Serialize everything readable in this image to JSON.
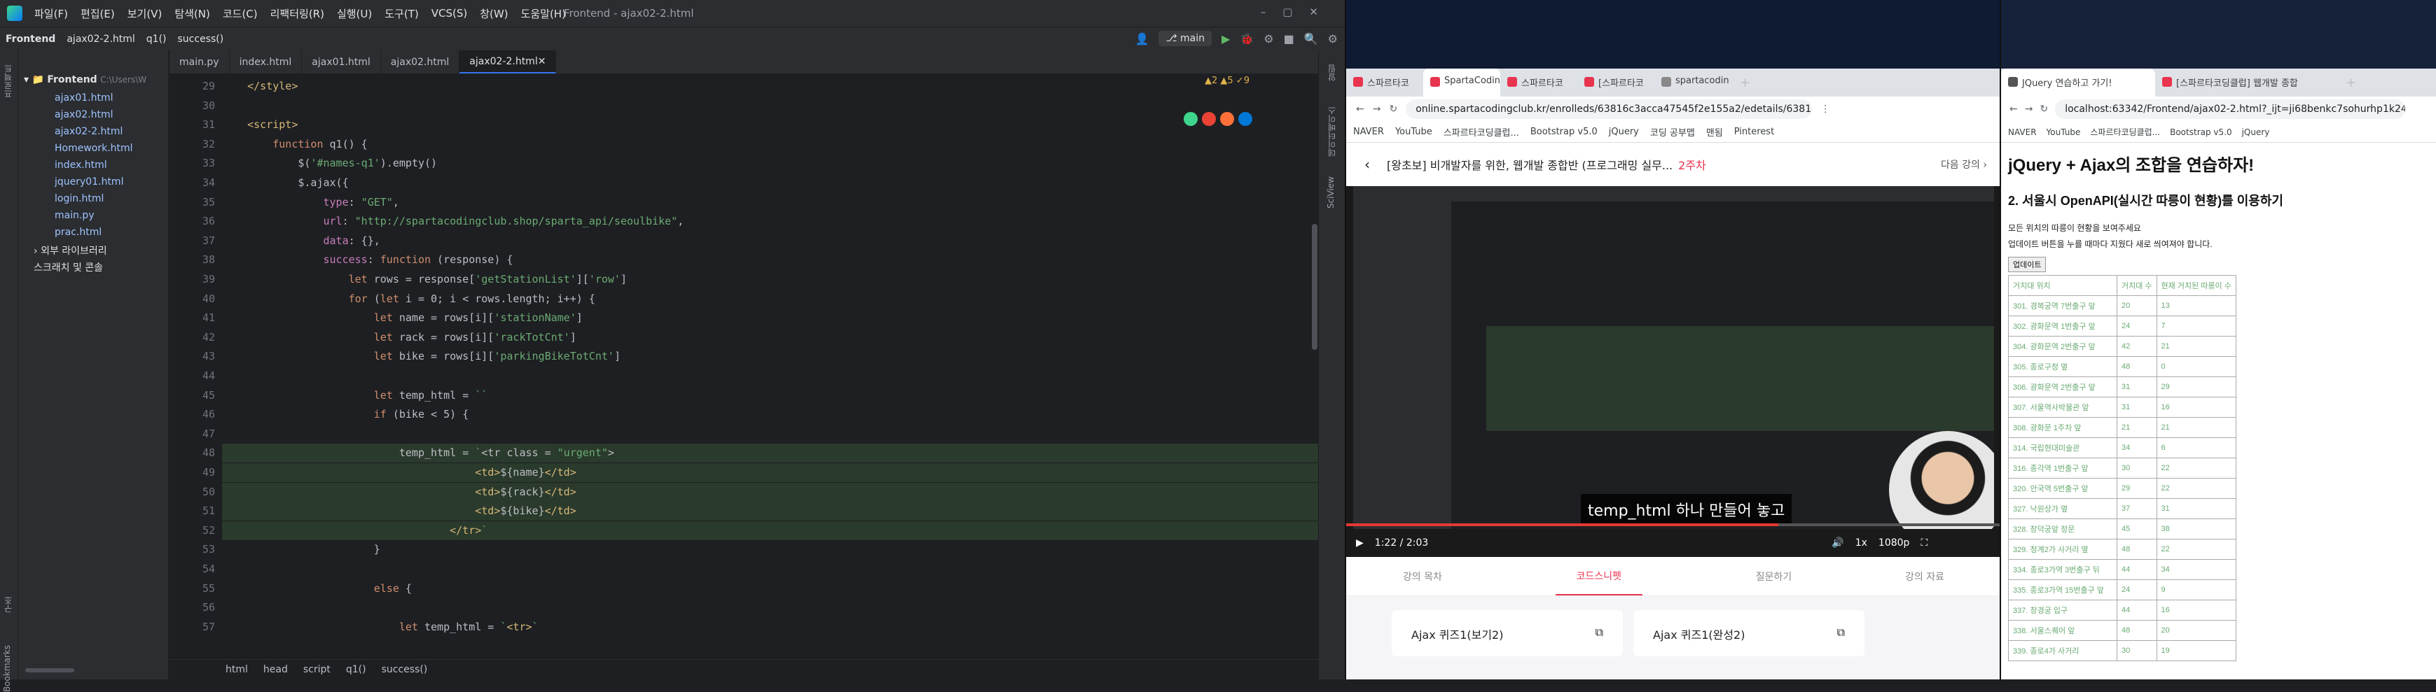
{
  "ide": {
    "menu": [
      "파일(F)",
      "편집(E)",
      "보기(V)",
      "탐색(N)",
      "코드(C)",
      "리팩터링(R)",
      "실행(U)",
      "도구(T)",
      "VCS(S)",
      "창(W)",
      "도움말(H)"
    ],
    "window_title": "Frontend - ajax02-2.html",
    "nav": [
      "Frontend",
      "ajax02-2.html",
      "q1()",
      "success()"
    ],
    "branch": "main",
    "project": {
      "root": "Frontend",
      "root_path": "C:\\Users\\W",
      "files": [
        "ajax01.html",
        "ajax02.html",
        "ajax02-2.html",
        "Homework.html",
        "index.html",
        "jquery01.html",
        "login.html",
        "main.py",
        "prac.html"
      ],
      "ext_lib": "외부 라이브러리",
      "scratch": "스크래치 및 콘솔"
    },
    "tabs": [
      "main.py",
      "index.html",
      "ajax01.html",
      "ajax02.html",
      "ajax02-2.html"
    ],
    "active_tab": "ajax02-2.html",
    "inspections": "▲2 ▲5 ✓9",
    "lines": [
      {
        "n": "29",
        "t": "    </style>"
      },
      {
        "n": "30",
        "t": ""
      },
      {
        "n": "31",
        "t": "    <script>"
      },
      {
        "n": "32",
        "t": "        function q1() {"
      },
      {
        "n": "33",
        "t": "            $('#names-q1').empty()"
      },
      {
        "n": "34",
        "t": "            $.ajax({"
      },
      {
        "n": "35",
        "t": "                type: \"GET\","
      },
      {
        "n": "36",
        "t": "                url: \"http://spartacodingclub.shop/sparta_api/seoulbike\","
      },
      {
        "n": "37",
        "t": "                data: {},"
      },
      {
        "n": "38",
        "t": "                success: function (response) {"
      },
      {
        "n": "39",
        "t": "                    let rows = response['getStationList']['row']"
      },
      {
        "n": "40",
        "t": "                    for (let i = 0; i < rows.length; i++) {"
      },
      {
        "n": "41",
        "t": "                        let name = rows[i]['stationName']"
      },
      {
        "n": "42",
        "t": "                        let rack = rows[i]['rackTotCnt']"
      },
      {
        "n": "43",
        "t": "                        let bike = rows[i]['parkingBikeTotCnt']"
      },
      {
        "n": "44",
        "t": ""
      },
      {
        "n": "45",
        "t": "                        let temp_html = ``"
      },
      {
        "n": "46",
        "t": "                        if (bike < 5) {"
      },
      {
        "n": "47",
        "t": ""
      },
      {
        "n": "48",
        "t": "                            temp_html = `<tr class = \"urgent\">"
      },
      {
        "n": "49",
        "t": "                                        <td>${name}</td>"
      },
      {
        "n": "50",
        "t": "                                        <td>${rack}</td>"
      },
      {
        "n": "51",
        "t": "                                        <td>${bike}</td>"
      },
      {
        "n": "52",
        "t": "                                    </tr>`"
      },
      {
        "n": "53",
        "t": "                        }"
      },
      {
        "n": "54",
        "t": ""
      },
      {
        "n": "55",
        "t": "                        else {"
      },
      {
        "n": "56",
        "t": ""
      },
      {
        "n": "57",
        "t": "                            let temp_html = `<tr>`"
      }
    ],
    "breadcrumb": [
      "html",
      "head",
      "script",
      "q1()",
      "success()"
    ],
    "left_tabs": [
      "프로젝트",
      "구조",
      "Bookmarks"
    ],
    "right_tabs": [
      "알림",
      "데이터베이스",
      "SciView"
    ]
  },
  "browser1": {
    "tabs": [
      "스파르타코",
      "SpartaCodin",
      "스파르타코",
      "[스파르타코",
      "spartacodin"
    ],
    "url": "online.spartacodingclub.kr/enrolleds/63816c3acca47545f2e155a2/edetails/63816c3acca...",
    "bookmarks": [
      "NAVER",
      "YouTube",
      "스파르타코딩클럽...",
      "Bootstrap v5.0",
      "jQuery",
      "코딩 공부맵",
      "맨됨",
      "Pinterest"
    ],
    "lecture_title": "[왕초보] 비개발자를 위한, 웹개발 종합반 (프로그래밍 실무...",
    "week": "2주차",
    "next": "다음 강의",
    "caption": "temp_html 하나 만들어 놓고",
    "time": "1:22 / 2:03",
    "quality": "1080p",
    "speed": "1x",
    "progress": 0.66,
    "nav": [
      "강의 목차",
      "코드스니펫",
      "질문하기",
      "강의 자료"
    ],
    "active_nav": "코드스니펫",
    "quiz": [
      "Ajax 퀴즈1(보기2)",
      "Ajax 퀴즈1(완성2)"
    ]
  },
  "browser2": {
    "tabs": [
      "JQuery 연습하고 가기!",
      "[스파르타코딩클럽] 웹개발 종합"
    ],
    "url": "localhost:63342/Frontend/ajax02-2.html?_ijt=ji68benkc7sohurhp1k24np1q",
    "bookmarks": [
      "NAVER",
      "YouTube",
      "스파르타코딩클럽...",
      "Bootstrap v5.0",
      "jQuery"
    ],
    "h1": "jQuery + Ajax의 조합을 연습하자!",
    "h2": "2. 서울시 OpenAPI(실시간 따릉이 현황)를 이용하기",
    "p1": "모든 위치의 따릉이 현황을 보여주세요",
    "p2": "업데이트 버튼을 누를 때마다 지웠다 새로 씌여져야 합니다.",
    "button": "업데이트",
    "headers": [
      "거치대 위치",
      "거치대 수",
      "현재 거치된 따릉이 수"
    ],
    "rows": [
      [
        "301. 경복궁역 7번출구 앞",
        "20",
        "13"
      ],
      [
        "302. 광화문역 1번출구 앞",
        "24",
        "7"
      ],
      [
        "304. 광화문역 2번출구 앞",
        "42",
        "21"
      ],
      [
        "305. 종로구청 옆",
        "48",
        "0"
      ],
      [
        "306. 광화문역 2번출구 앞",
        "31",
        "29"
      ],
      [
        "307. 서울역사박물관 앞",
        "31",
        "16"
      ],
      [
        "308. 광화문 1주차 앞",
        "21",
        "21"
      ],
      [
        "314. 국립현대미술관",
        "34",
        "6"
      ],
      [
        "316. 종각역 1번출구 앞",
        "30",
        "22"
      ],
      [
        "320. 안국역 5번출구 앞",
        "29",
        "22"
      ],
      [
        "327. 낙원상가 옆",
        "37",
        "31"
      ],
      [
        "328. 창덕궁앞 정문",
        "45",
        "38"
      ],
      [
        "329. 청계2가 사거리 옆",
        "48",
        "22"
      ],
      [
        "334. 종로3가역 3번출구 뒤",
        "44",
        "34"
      ],
      [
        "335. 종로3가역 15번출구 앞",
        "24",
        "9"
      ],
      [
        "337. 창경궁 입구",
        "44",
        "16"
      ],
      [
        "338. 서울스퀘어 앞",
        "48",
        "20"
      ],
      [
        "339. 종로4가 사거리",
        "30",
        "19"
      ]
    ]
  }
}
